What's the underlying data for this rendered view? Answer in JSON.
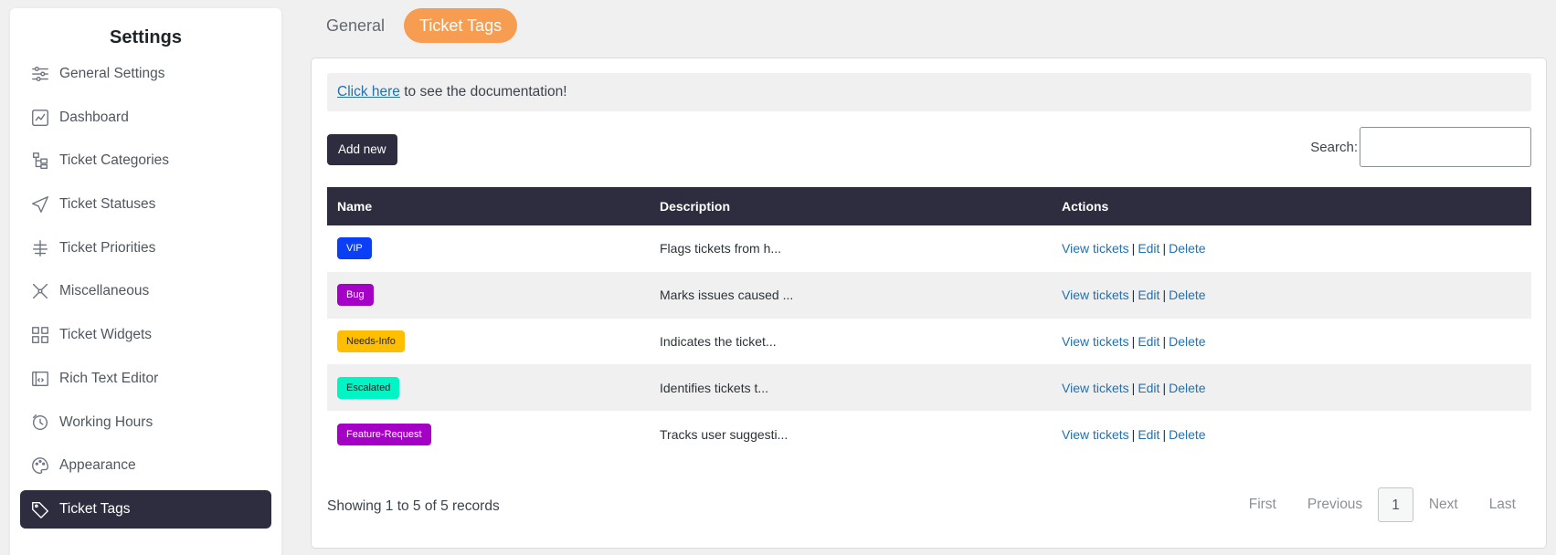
{
  "sidebar": {
    "title": "Settings",
    "items": [
      {
        "label": "General Settings",
        "icon": "sliders-icon"
      },
      {
        "label": "Dashboard",
        "icon": "chart-icon"
      },
      {
        "label": "Ticket Categories",
        "icon": "hierarchy-icon"
      },
      {
        "label": "Ticket Statuses",
        "icon": "send-icon"
      },
      {
        "label": "Ticket Priorities",
        "icon": "priority-icon"
      },
      {
        "label": "Miscellaneous",
        "icon": "tools-icon"
      },
      {
        "label": "Ticket Widgets",
        "icon": "widgets-icon"
      },
      {
        "label": "Rich Text Editor",
        "icon": "code-window-icon"
      },
      {
        "label": "Working Hours",
        "icon": "clock-icon"
      },
      {
        "label": "Appearance",
        "icon": "palette-icon"
      },
      {
        "label": "Ticket Tags",
        "icon": "tag-icon",
        "active": true
      }
    ]
  },
  "tabs": [
    {
      "label": "General",
      "active": false
    },
    {
      "label": "Ticket Tags",
      "active": true
    }
  ],
  "doc": {
    "link_text": "Click here",
    "rest_text": " to see the documentation!"
  },
  "toolbar": {
    "add_label": "Add new",
    "search_label": "Search:",
    "search_value": ""
  },
  "table": {
    "headers": [
      "Name",
      "Description",
      "Actions"
    ],
    "rows": [
      {
        "name": "VIP",
        "color": "#0b3ff5",
        "text_color": "#ffffff",
        "description": "Flags tickets from h..."
      },
      {
        "name": "Bug",
        "color": "#a400c6",
        "text_color": "#ffffff",
        "description": "Marks issues caused ..."
      },
      {
        "name": "Needs-Info",
        "color": "#ffbf00",
        "text_color": "#1d2327",
        "description": "Indicates the ticket..."
      },
      {
        "name": "Escalated",
        "color": "#00f5c4",
        "text_color": "#1d2327",
        "description": "Identifies tickets t..."
      },
      {
        "name": "Feature-Request",
        "color": "#a400c6",
        "text_color": "#ffffff",
        "description": "Tracks user suggesti..."
      }
    ],
    "actions": {
      "view": "View tickets",
      "edit": "Edit",
      "delete": "Delete",
      "separator": "|"
    }
  },
  "footer": {
    "info": "Showing 1 to 5 of 5 records",
    "pagination": {
      "first": "First",
      "previous": "Previous",
      "current": "1",
      "next": "Next",
      "last": "Last"
    }
  },
  "colors": {
    "accent": "#f79d52",
    "dark": "#2d2d3f",
    "link": "#2271b1"
  }
}
